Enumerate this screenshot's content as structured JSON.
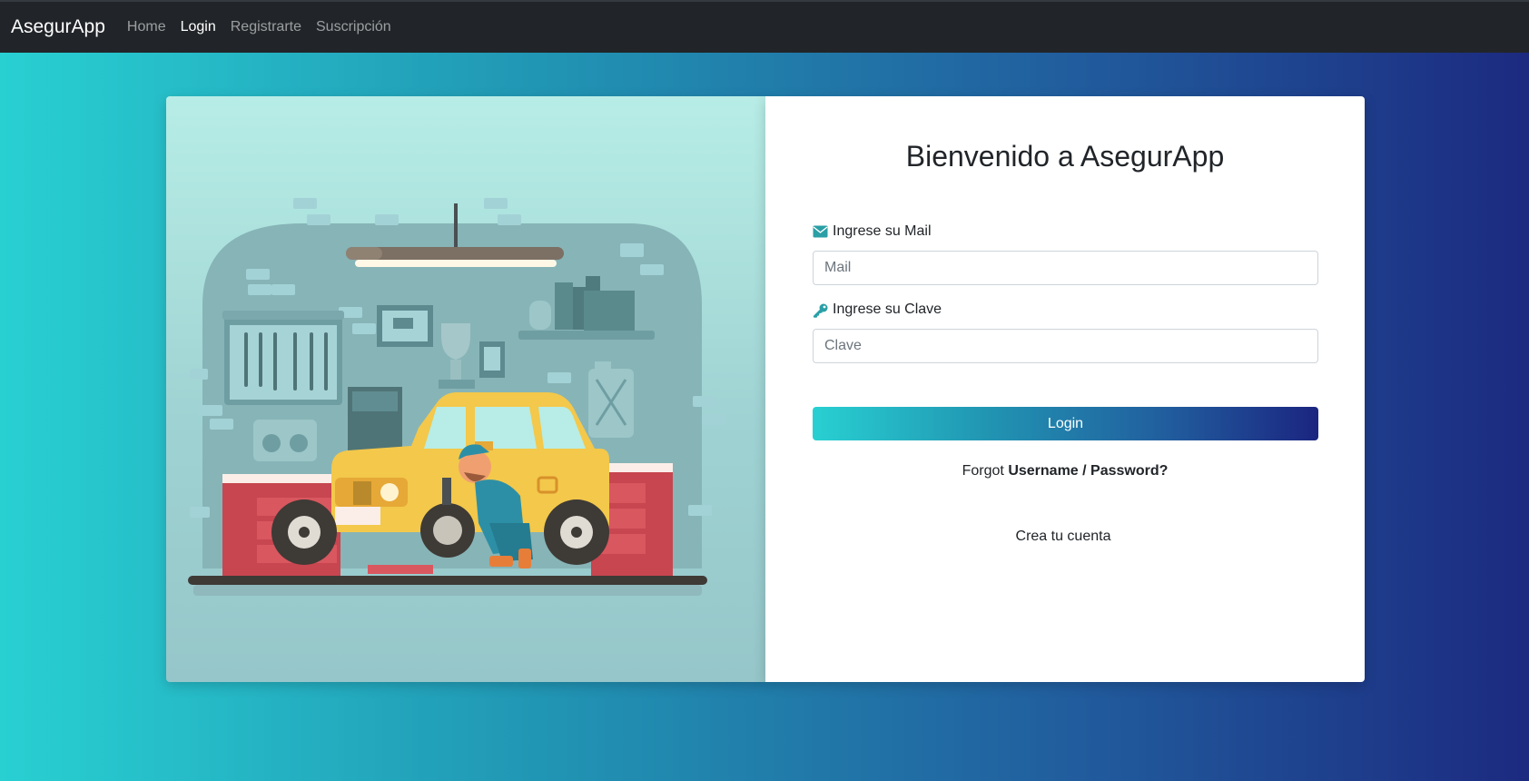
{
  "navbar": {
    "brand": "AsegurApp",
    "links": [
      {
        "label": "Home",
        "active": false
      },
      {
        "label": "Login",
        "active": true
      },
      {
        "label": "Registrarte",
        "active": false
      },
      {
        "label": "Suscripción",
        "active": false
      }
    ]
  },
  "login_card": {
    "title": "Bienvenido a AsegurApp",
    "mail_label": "Ingrese su Mail",
    "mail_icon": "envelope-icon",
    "mail_placeholder": "Mail",
    "password_label": "Ingrese su Clave",
    "password_icon": "key-icon",
    "password_placeholder": "Clave",
    "login_button": "Login",
    "forgot_prefix": "Forgot",
    "forgot_link": "Username / Password?",
    "create_account": "Crea tu cuenta"
  },
  "colors": {
    "navbar_bg": "#212529",
    "gradient_start": "#28d0d2",
    "gradient_end": "#1c2a80",
    "icon_accent": "#2a9fa6"
  }
}
